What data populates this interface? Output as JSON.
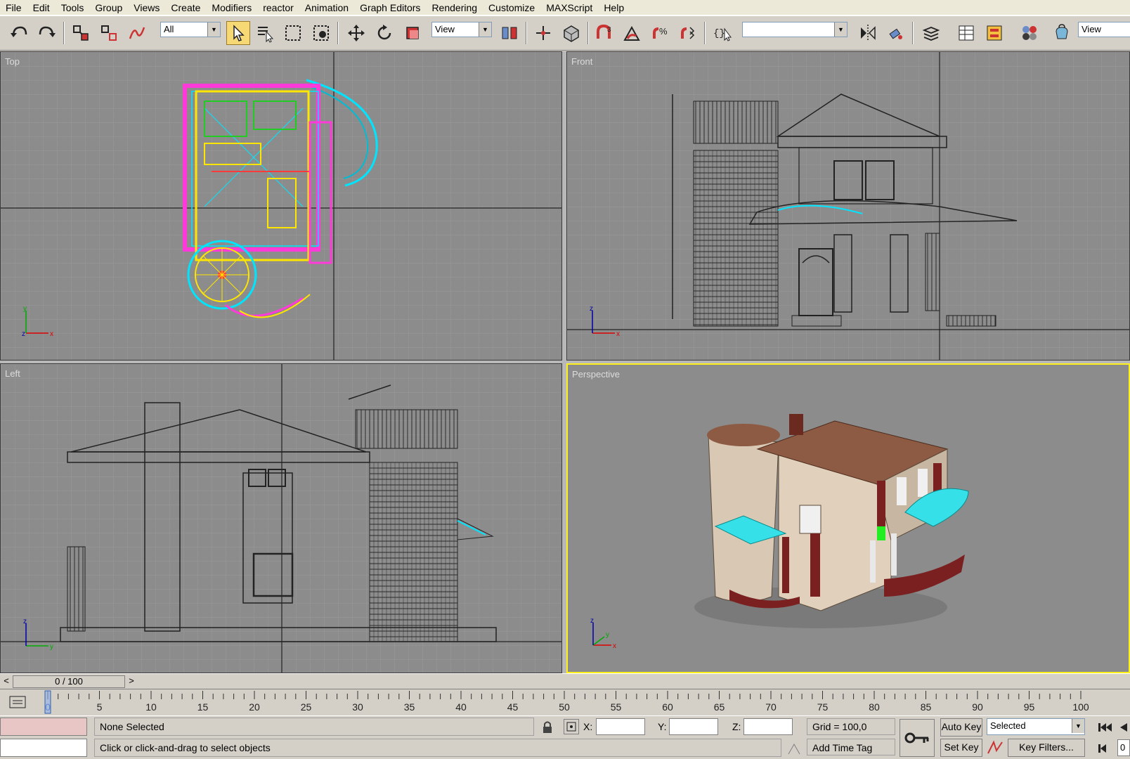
{
  "menu": [
    "File",
    "Edit",
    "Tools",
    "Group",
    "Views",
    "Create",
    "Modifiers",
    "reactor",
    "Animation",
    "Graph Editors",
    "Rendering",
    "Customize",
    "MAXScript",
    "Help"
  ],
  "toolbar": {
    "filter": "All",
    "ref_coord": "View",
    "named_selection": "",
    "ref_coord_right": "View"
  },
  "viewports": {
    "top": {
      "label": "Top"
    },
    "front": {
      "label": "Front"
    },
    "left": {
      "label": "Left"
    },
    "perspective": {
      "label": "Perspective"
    }
  },
  "axis": {
    "x": "x",
    "y": "y",
    "z": "z"
  },
  "timeline": {
    "slider": "0 / 100",
    "prev": "<",
    "next": ">",
    "ticks": [
      "0",
      "5",
      "10",
      "15",
      "20",
      "25",
      "30",
      "35",
      "40",
      "45",
      "50",
      "55",
      "60",
      "65",
      "70",
      "75",
      "80",
      "85",
      "90",
      "95",
      "100"
    ]
  },
  "status": {
    "selection": "None Selected",
    "prompt": "Click or click-and-drag to select objects",
    "x_label": "X:",
    "y_label": "Y:",
    "z_label": "Z:",
    "x_value": "",
    "y_value": "",
    "z_value": "",
    "grid": "Grid = 100,0",
    "add_time_tag": "Add Time Tag",
    "auto_key": "Auto Key",
    "set_key": "Set Key",
    "key_mode": "Selected",
    "key_filters": "Key Filters...",
    "frame": "0"
  },
  "colors": {
    "viewport_bg": "#8c8c8c",
    "active_border": "#ffef1a",
    "ui_bg": "#d4d0c8"
  }
}
